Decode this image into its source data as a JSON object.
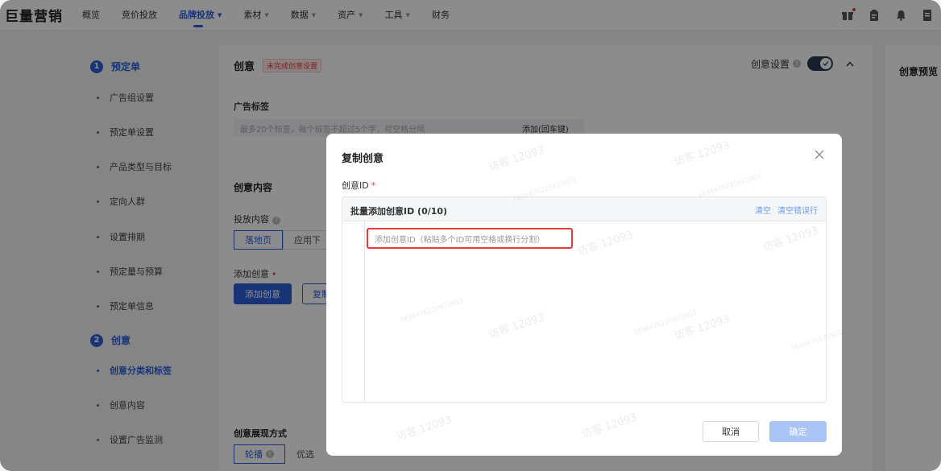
{
  "app": {
    "logo": "巨量营销"
  },
  "nav": {
    "items": [
      {
        "label": "概览",
        "caret": false,
        "active": false
      },
      {
        "label": "竞价投放",
        "caret": false,
        "active": false
      },
      {
        "label": "品牌投放",
        "caret": true,
        "active": true
      },
      {
        "label": "素材",
        "caret": true,
        "active": false
      },
      {
        "label": "数据",
        "caret": true,
        "active": false
      },
      {
        "label": "资产",
        "caret": true,
        "active": false
      },
      {
        "label": "工具",
        "caret": true,
        "active": false
      },
      {
        "label": "财务",
        "caret": false,
        "active": false
      }
    ],
    "caret_glyph": "▼"
  },
  "steps": {
    "step1": {
      "num": "1",
      "title": "预定单"
    },
    "step1_items": [
      "广告组设置",
      "预定单设置",
      "产品类型与目标",
      "定向人群",
      "设置排期",
      "预定量与预算",
      "预定单信息"
    ],
    "step2": {
      "num": "2",
      "title": "创意"
    },
    "step2_items": [
      "创意分类和标签",
      "创意内容",
      "设置广告监测"
    ]
  },
  "card": {
    "title": "创意",
    "badge": "未完成创意设置",
    "settings_label": "创意设置",
    "ad_tags_label": "广告标签",
    "ad_tags_placeholder": "最多20个标签，每个标签不超过5个字，可空格分隔",
    "ad_tags_add": "添加(回车键)",
    "content_title": "创意内容",
    "delivery_label": "投放内容",
    "delivery_options": [
      "落地页",
      "应用下"
    ],
    "add_creative_label": "添加创意",
    "add_creative_btn": "添加创意",
    "copy_btn_partial": "复制",
    "display_title": "创意展现方式",
    "display_options": [
      "轮播",
      "优选"
    ]
  },
  "preview": {
    "title": "创意预览"
  },
  "modal": {
    "title": "复制创意",
    "field_label": "创意ID",
    "required_mark": "*",
    "batch_title": "批量添加创意ID (0/10)",
    "clear": "清空",
    "clear_errors": "清空错误行",
    "input_placeholder": "添加创意ID（粘贴多个ID可用空格或换行分割）",
    "cancel": "取消",
    "confirm": "确定"
  },
  "watermark": {
    "text": "访客 12093",
    "id": "1698476220923803"
  },
  "colors": {
    "primary": "#2f5fd8",
    "danger": "#e5393a",
    "link": "#6b9cf0"
  }
}
